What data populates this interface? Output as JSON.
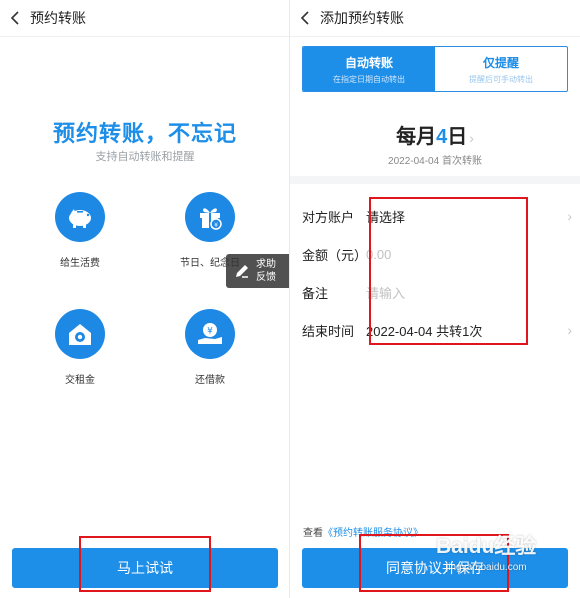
{
  "left": {
    "title": "预约转账",
    "hero_title": "预约转账，不忘记",
    "hero_subtitle": "支持自动转账和提醒",
    "features": [
      {
        "label": "给生活费",
        "icon": "piggy-bank-icon"
      },
      {
        "label": "节日、纪念日",
        "icon": "gift-box-icon"
      },
      {
        "label": "交租金",
        "icon": "house-icon"
      },
      {
        "label": "还借款",
        "icon": "yuan-hand-icon"
      }
    ],
    "help_line1": "求助",
    "help_line2": "反馈",
    "try_button": "马上试试"
  },
  "right": {
    "title": "添加预约转账",
    "tab_auto": "自动转账",
    "tab_auto_sub": "在指定日期自动转出",
    "tab_remind": "仅提醒",
    "tab_remind_sub": "提醒后可手动转出",
    "schedule_prefix": "每月",
    "schedule_day": "4",
    "schedule_suffix": "日",
    "schedule_sub": "2022-04-04 首次转账",
    "rows": [
      {
        "label": "对方账户",
        "value": "请选择"
      },
      {
        "label": "金额（元）",
        "value": "0.00"
      },
      {
        "label": "备注",
        "value": "请输入"
      },
      {
        "label": "结束时间",
        "value": "2022-04-04 共转1次"
      }
    ],
    "agreement_prefix": "查看",
    "agreement_link": "《预约转账服务协议》",
    "save_button": "同意协议并保存"
  },
  "watermark": {
    "logo": "Baidu经验",
    "url": "jingyan.baidu.com"
  },
  "colors": {
    "accent": "#1e8fe8",
    "highlight_box": "#e0161c"
  }
}
